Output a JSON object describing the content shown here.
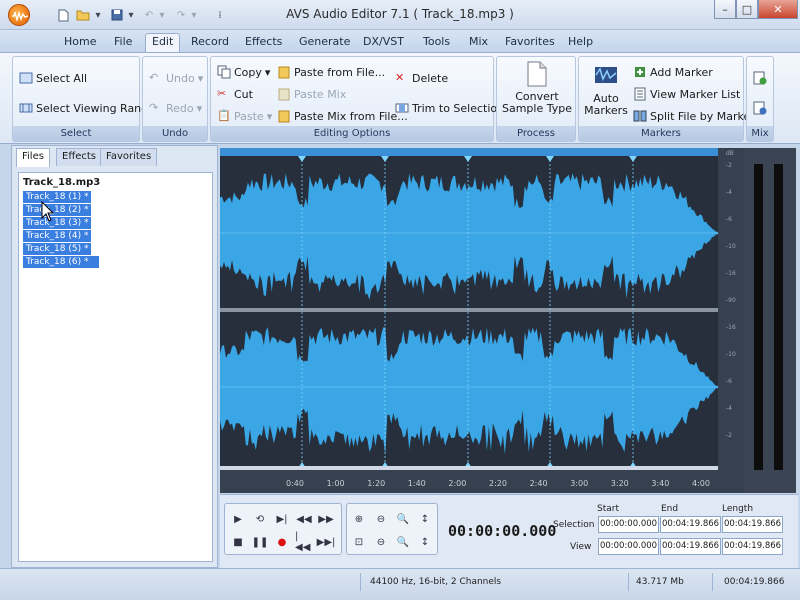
{
  "title": "AVS Audio Editor 7.1  ( Track_18.mp3 )",
  "menu_tabs": [
    "Home",
    "File",
    "Edit",
    "Record",
    "Effects",
    "Generate",
    "DX/VST",
    "Tools",
    "Mix",
    "Favorites",
    "Help"
  ],
  "active_tab": "Edit",
  "ribbon": {
    "select": {
      "label": "Select",
      "select_all": "Select All",
      "select_viewing_range": "Select Viewing Range"
    },
    "undo": {
      "label": "Undo",
      "undo": "Undo",
      "redo": "Redo"
    },
    "editing": {
      "label": "Editing Options",
      "copy": "Copy",
      "cut": "Cut",
      "paste": "Paste",
      "paste_from_file": "Paste from File...",
      "paste_mix": "Paste Mix",
      "paste_mix_from_file": "Paste Mix from File...",
      "delete": "Delete",
      "trim_to_selection": "Trim to Selection"
    },
    "process": {
      "label": "Process",
      "convert_line1": "Convert",
      "convert_line2": "Sample Type"
    },
    "markers": {
      "label": "Markers",
      "auto_line1": "Auto",
      "auto_line2": "Markers",
      "add_marker": "Add Marker",
      "view_marker_list": "View Marker List",
      "split_file": "Split File by Markers"
    },
    "mix": {
      "label": "Mix"
    }
  },
  "panel_tabs": [
    "Files",
    "Effects",
    "Favorites"
  ],
  "files": {
    "root": "Track_18.mp3",
    "items": [
      "Track_18 (1) *",
      "Track_18 (2) *",
      "Track_18 (3) *",
      "Track_18 (4) *",
      "Track_18 (5) *",
      "Track_18 (6) *"
    ]
  },
  "timeline_ticks": [
    "0:40",
    "1:00",
    "1:20",
    "1:40",
    "2:00",
    "2:20",
    "2:40",
    "3:00",
    "3:20",
    "3:40",
    "4:00"
  ],
  "vscale_ticks": [
    "dB",
    "-2",
    "-4",
    "-6",
    "-10",
    "-16",
    "-90",
    "-16",
    "-10",
    "-6",
    "-4",
    "-2"
  ],
  "transport": {
    "time": "00:00:00.000",
    "headers": {
      "start": "Start",
      "end": "End",
      "length": "Length"
    },
    "selection_label": "Selection",
    "view_label": "View",
    "selection": {
      "start": "00:00:00.000",
      "end": "00:04:19.866",
      "length": "00:04:19.866"
    },
    "view": {
      "start": "00:00:00.000",
      "end": "00:04:19.866",
      "length": "00:04:19.866"
    }
  },
  "status": {
    "format": "44100 Hz, 16-bit, 2 Channels",
    "size": "43.717 Mb",
    "duration": "00:04:19.866"
  },
  "colors": {
    "waveform": "#3aa6e6",
    "wave_bg": "#262f3b",
    "selection": "#3a7ee0",
    "marker": "#7fd6ff"
  }
}
